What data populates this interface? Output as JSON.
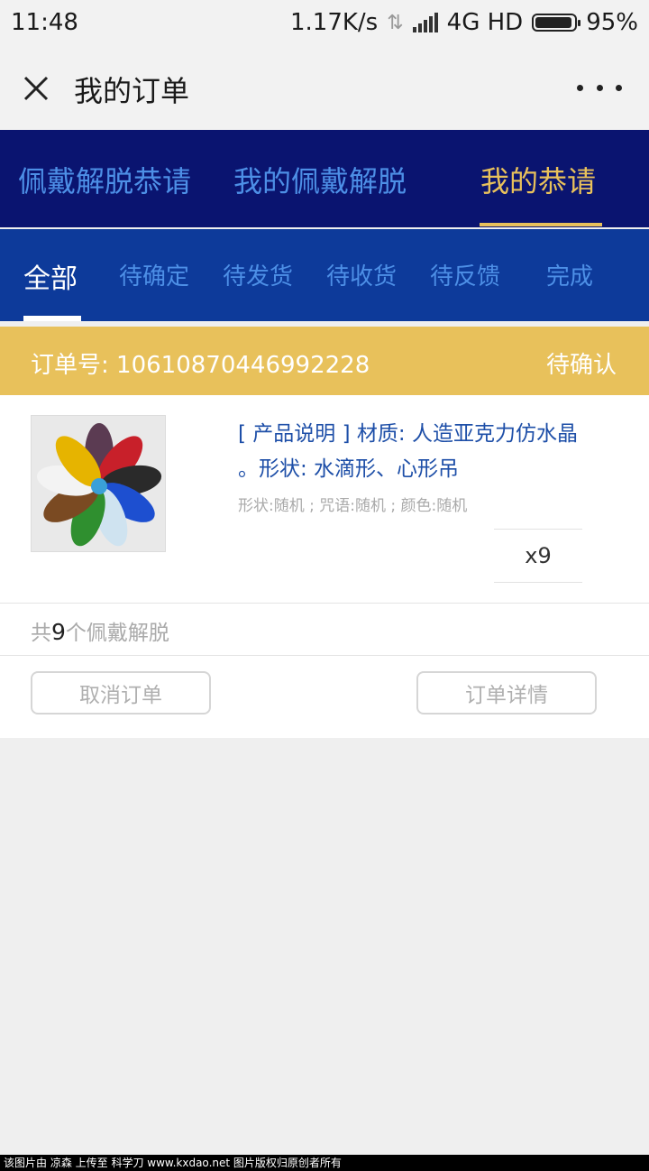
{
  "status_bar": {
    "time": "11:48",
    "network_speed": "1.17K/s",
    "network": "4G HD",
    "battery": "95%",
    "battery_level": 0.95
  },
  "nav": {
    "title": "我的订单",
    "close_icon": "close-icon",
    "more_icon": "more-icon"
  },
  "top_tabs": [
    {
      "label": "佩戴解脱恭请",
      "active": false
    },
    {
      "label": "我的佩戴解脱",
      "active": false
    },
    {
      "label": "我的恭请",
      "active": true
    }
  ],
  "sub_tabs": [
    {
      "label": "全部",
      "active": true
    },
    {
      "label": "待确定",
      "active": false
    },
    {
      "label": "待发货",
      "active": false
    },
    {
      "label": "待收货",
      "active": false
    },
    {
      "label": "待反馈",
      "active": false
    },
    {
      "label": "完成",
      "active": false
    }
  ],
  "order": {
    "number_label": "订单号: 10610870446992228",
    "status": "待确认",
    "product_title": "[ 产品说明 ] 材质: 人造亚克力仿水晶 。形状: 水滴形、心形吊",
    "product_spec": "形状:随机 ; 咒语:随机 ; 颜色:随机",
    "quantity": "x9",
    "total_prefix": "共",
    "total_count": "9",
    "total_suffix": "个佩戴解脱",
    "cancel_button": "取消订单",
    "detail_button": "订单详情"
  },
  "watermark": "该图片由 凉森 上传至 科学刀 www.kxdao.net 图片版权归原创者所有",
  "colors": {
    "top_tabs_bg": "#0a1470",
    "sub_tabs_bg": "#0d3a9a",
    "accent_gold": "#e8c15b",
    "inactive_tab": "#4d8fe6",
    "product_title": "#1e4fa8"
  }
}
